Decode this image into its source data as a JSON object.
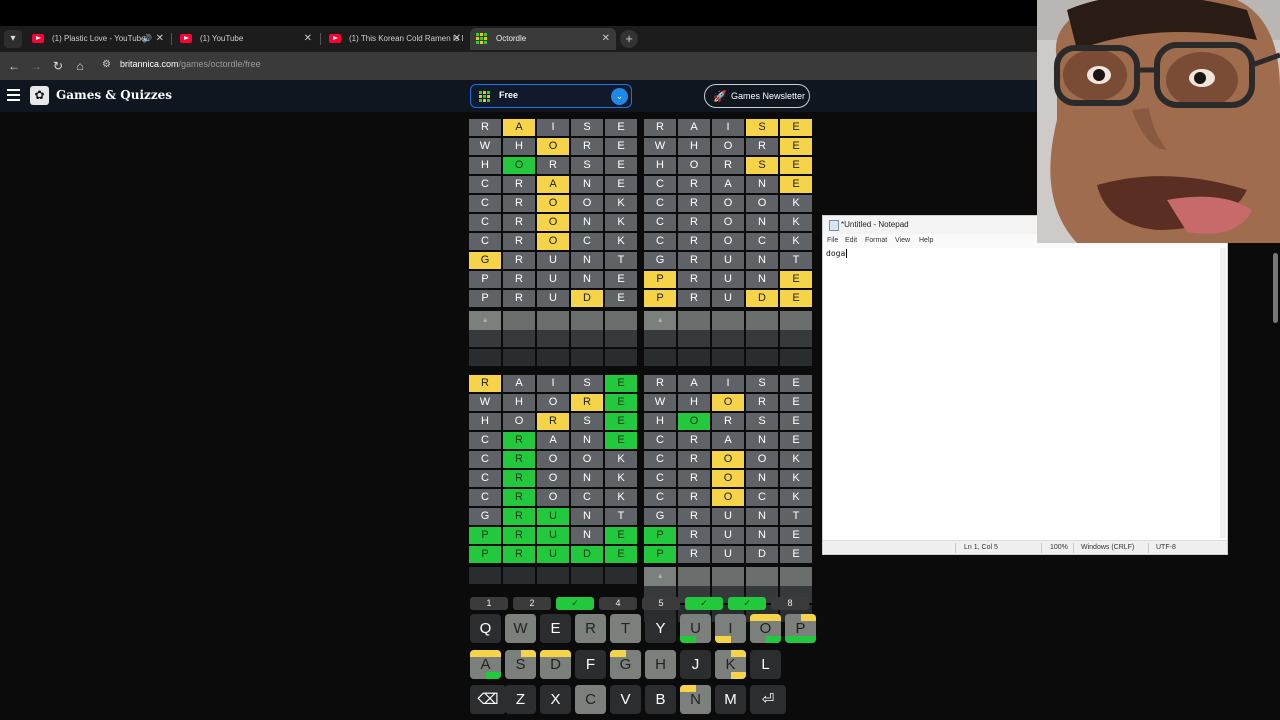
{
  "browser": {
    "tabs": [
      {
        "title": "(1) Plastic Love - YouTube",
        "favicon": "youtube-icon",
        "audio": true
      },
      {
        "title": "(1) YouTube",
        "favicon": "youtube-icon",
        "audio": false
      },
      {
        "title": "(1) This Korean Cold Ramen Is I",
        "favicon": "youtube-icon",
        "audio": false
      },
      {
        "title": "Octordle",
        "favicon": "octordle-grid-icon",
        "audio": false,
        "active": true
      }
    ],
    "url_domain": "britannica.com",
    "url_path": "/games/octordle/free"
  },
  "site": {
    "title": "Games & Quizzes",
    "mode_select": "Free",
    "newsletter": "Games Newsletter"
  },
  "colors": {
    "yellow": "#f6d44a",
    "green": "#22c93c",
    "gray": "#5f6367",
    "accent": "#1a73e8"
  },
  "boards": [
    {
      "rows": [
        [
          "R",
          "A",
          "I",
          "S",
          "E"
        ],
        [
          "W",
          "H",
          "O",
          "R",
          "E"
        ],
        [
          "H",
          "O",
          "R",
          "S",
          "E"
        ],
        [
          "C",
          "R",
          "A",
          "N",
          "E"
        ],
        [
          "C",
          "R",
          "O",
          "O",
          "K"
        ],
        [
          "C",
          "R",
          "O",
          "N",
          "K"
        ],
        [
          "C",
          "R",
          "O",
          "C",
          "K"
        ],
        [
          "G",
          "R",
          "U",
          "N",
          "T"
        ],
        [
          "P",
          "R",
          "U",
          "N",
          "E"
        ],
        [
          "P",
          "R",
          "U",
          "D",
          "E"
        ]
      ],
      "states": [
        "-y---",
        "--y--",
        "-g---",
        "--y--",
        "--y--",
        "--y--",
        "--y--",
        "y----",
        "-----",
        "---y-"
      ],
      "current": [
        "a",
        "",
        "",
        "",
        ""
      ]
    },
    {
      "rows": [
        [
          "R",
          "A",
          "I",
          "S",
          "E"
        ],
        [
          "W",
          "H",
          "O",
          "R",
          "E"
        ],
        [
          "H",
          "O",
          "R",
          "S",
          "E"
        ],
        [
          "C",
          "R",
          "A",
          "N",
          "E"
        ],
        [
          "C",
          "R",
          "O",
          "O",
          "K"
        ],
        [
          "C",
          "R",
          "O",
          "N",
          "K"
        ],
        [
          "C",
          "R",
          "O",
          "C",
          "K"
        ],
        [
          "G",
          "R",
          "U",
          "N",
          "T"
        ],
        [
          "P",
          "R",
          "U",
          "N",
          "E"
        ],
        [
          "P",
          "R",
          "U",
          "D",
          "E"
        ]
      ],
      "states": [
        "---yy",
        "----y",
        "---yy",
        "----y",
        "-----",
        "-----",
        "-----",
        "-----",
        "y---y",
        "y--yy"
      ],
      "current": [
        "a",
        "",
        "",
        "",
        ""
      ]
    },
    {
      "rows": [
        [
          "R",
          "A",
          "I",
          "S",
          "E"
        ],
        [
          "W",
          "H",
          "O",
          "R",
          "E"
        ],
        [
          "H",
          "O",
          "R",
          "S",
          "E"
        ],
        [
          "C",
          "R",
          "A",
          "N",
          "E"
        ],
        [
          "C",
          "R",
          "O",
          "O",
          "K"
        ],
        [
          "C",
          "R",
          "O",
          "N",
          "K"
        ],
        [
          "C",
          "R",
          "O",
          "C",
          "K"
        ],
        [
          "G",
          "R",
          "U",
          "N",
          "T"
        ],
        [
          "P",
          "R",
          "U",
          "N",
          "E"
        ],
        [
          "P",
          "R",
          "U",
          "D",
          "E"
        ]
      ],
      "states": [
        "y---g",
        "---yg",
        "--y-g",
        "-g--g",
        "-g---",
        "-g---",
        "-g---",
        "-gg--",
        "ggg-g",
        "ggggg"
      ],
      "current": null
    },
    {
      "rows": [
        [
          "R",
          "A",
          "I",
          "S",
          "E"
        ],
        [
          "W",
          "H",
          "O",
          "R",
          "E"
        ],
        [
          "H",
          "O",
          "R",
          "S",
          "E"
        ],
        [
          "C",
          "R",
          "A",
          "N",
          "E"
        ],
        [
          "C",
          "R",
          "O",
          "O",
          "K"
        ],
        [
          "C",
          "R",
          "O",
          "N",
          "K"
        ],
        [
          "C",
          "R",
          "O",
          "C",
          "K"
        ],
        [
          "G",
          "R",
          "U",
          "N",
          "T"
        ],
        [
          "P",
          "R",
          "U",
          "N",
          "E"
        ],
        [
          "P",
          "R",
          "U",
          "D",
          "E"
        ]
      ],
      "states": [
        "-----",
        "--y--",
        "-g---",
        "-----",
        "--y--",
        "--y--",
        "--y--",
        "-----",
        "g----",
        "g----"
      ],
      "current": [
        "a",
        "",
        "",
        "",
        ""
      ]
    }
  ],
  "board_indicators": [
    {
      "label": "1",
      "solved": false
    },
    {
      "label": "2",
      "solved": false
    },
    {
      "label": "✓",
      "solved": true
    },
    {
      "label": "4",
      "solved": false
    },
    {
      "label": "5",
      "solved": false
    },
    {
      "label": "✓",
      "solved": true
    },
    {
      "label": "✓",
      "solved": true
    },
    {
      "label": "8",
      "solved": false
    }
  ],
  "keyboard": [
    [
      "Q",
      "W",
      "E",
      "R",
      "T",
      "Y",
      "U",
      "I",
      "O",
      "P"
    ],
    [
      "A",
      "S",
      "D",
      "F",
      "G",
      "H",
      "J",
      "K",
      "L"
    ],
    [
      "⌫",
      "Z",
      "X",
      "C",
      "V",
      "B",
      "N",
      "M",
      "⏎"
    ]
  ],
  "notepad": {
    "title": "*Untitled - Notepad",
    "menu": [
      "File",
      "Edit",
      "Format",
      "View",
      "Help"
    ],
    "content": "doga",
    "status_position": "Ln 1, Col 5",
    "status_zoom": "100%",
    "status_eol": "Windows (CRLF)",
    "status_encoding": "UTF-8"
  }
}
